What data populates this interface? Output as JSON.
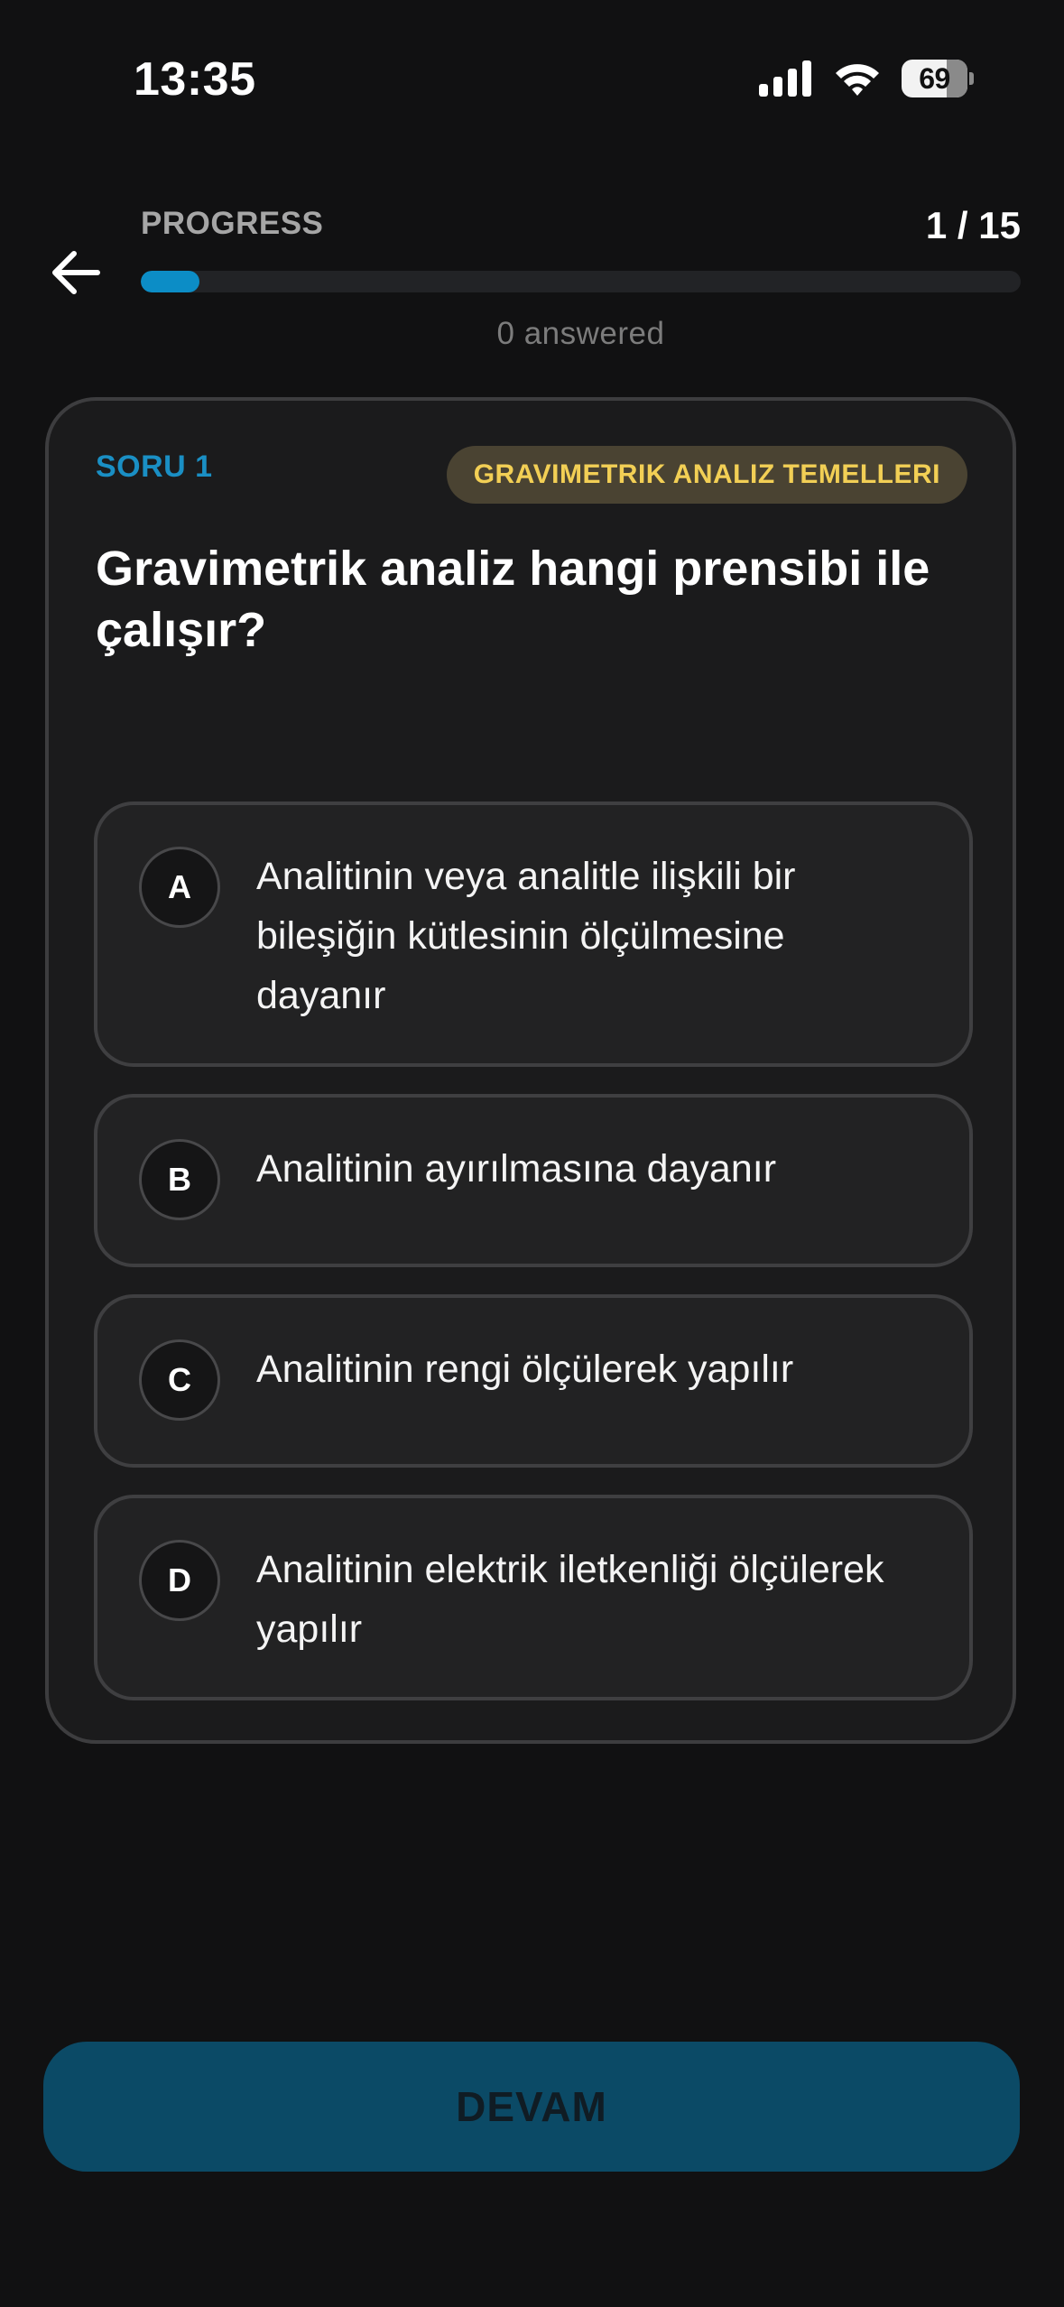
{
  "status_bar": {
    "time": "13:35",
    "battery_level": "69",
    "signal_icon": "cellular-signal-icon",
    "wifi_icon": "wifi-icon",
    "battery_icon": "battery-icon"
  },
  "header": {
    "back_icon": "arrow-left-icon",
    "progress_label": "PROGRESS",
    "progress_count": "1 / 15",
    "progress_fraction": 0.067,
    "answered_text": "0 answered"
  },
  "question": {
    "number_label": "SORU 1",
    "topic": "GRAVIMETRIK ANALIZ TEMELLERI",
    "text": "Gravimetrik analiz hangi prensibi ile çalışır?",
    "options": [
      {
        "letter": "A",
        "text": "Analitinin veya analitle ilişkili bir bileşiğin kütlesinin ölçülmesine dayanır"
      },
      {
        "letter": "B",
        "text": "Analitinin ayırılmasına dayanır"
      },
      {
        "letter": "C",
        "text": "Analitinin rengi ölçülerek yapılır"
      },
      {
        "letter": "D",
        "text": "Analitinin elektrik iletkenliği ölçülerek yapılır"
      }
    ]
  },
  "footer": {
    "continue_label": "DEVAM"
  },
  "colors": {
    "background": "#111112",
    "accent": "#0c8dc6",
    "question_number": "#1a8fc4",
    "badge_background": "#4a4332",
    "badge_text": "#f2cf55",
    "continue_button": "#0b4a66"
  }
}
